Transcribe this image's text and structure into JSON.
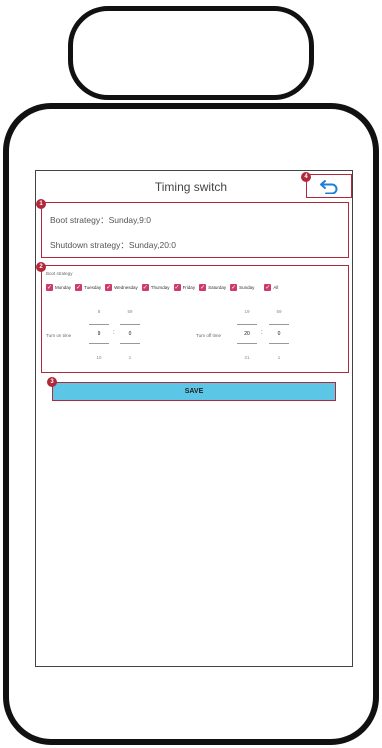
{
  "header": {
    "title": "Timing switch"
  },
  "badges": {
    "b1": "1",
    "b2": "2",
    "b3": "3",
    "b4": "4"
  },
  "icons": {
    "back": "back-arrow-icon"
  },
  "summary": {
    "boot": "Boot strategy：Sunday,9:0",
    "shutdown": "Shutdown strategy：Sunday,20:0"
  },
  "config": {
    "section_label": "Boot strategy",
    "days": [
      "Monday",
      "Tuesday",
      "Wednesday",
      "Thursday",
      "Friday",
      "Saturday",
      "Sunday",
      "All"
    ],
    "turn_on_label": "Turn on time",
    "turn_off_label": "Turn off time",
    "on": {
      "hour_prev": "8",
      "hour": "9",
      "hour_next": "10",
      "min_prev": "59",
      "min": "0",
      "min_next": "1"
    },
    "off": {
      "hour_prev": "19",
      "hour": "20",
      "hour_next": "21",
      "min_prev": "59",
      "min": "0",
      "min_next": "1"
    }
  },
  "save_label": "SAVE",
  "colors": {
    "accent": "#b0283a",
    "checkbox": "#d03a66",
    "save_bg": "#5bc6e5"
  }
}
